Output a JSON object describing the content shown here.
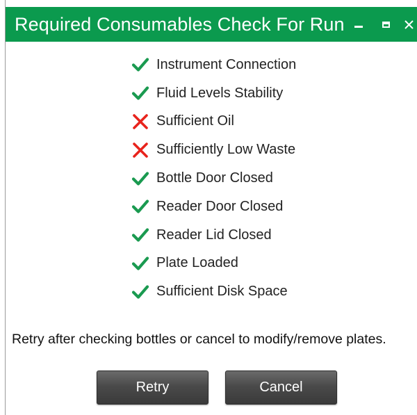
{
  "window": {
    "title": "Required Consumables Check For Run",
    "title_bar_color": "#0b9a4e",
    "controls": [
      "minimize-icon",
      "maximize-icon",
      "close-icon"
    ]
  },
  "checks": [
    {
      "label": "Instrument Connection",
      "status": "pass",
      "icon": "checkmark-icon"
    },
    {
      "label": "Fluid Levels Stability",
      "status": "pass",
      "icon": "checkmark-icon"
    },
    {
      "label": "Sufficient Oil",
      "status": "fail",
      "icon": "cross-icon"
    },
    {
      "label": "Sufficiently Low Waste",
      "status": "fail",
      "icon": "cross-icon"
    },
    {
      "label": "Bottle Door Closed",
      "status": "pass",
      "icon": "checkmark-icon"
    },
    {
      "label": "Reader Door Closed",
      "status": "pass",
      "icon": "checkmark-icon"
    },
    {
      "label": "Reader Lid Closed",
      "status": "pass",
      "icon": "checkmark-icon"
    },
    {
      "label": "Plate Loaded",
      "status": "pass",
      "icon": "checkmark-icon"
    },
    {
      "label": "Sufficient Disk Space",
      "status": "pass",
      "icon": "checkmark-icon"
    }
  ],
  "colors": {
    "pass": "#1a9a50",
    "fail": "#e8231c"
  },
  "message": "Retry after checking bottles or cancel to modify/remove plates.",
  "buttons": {
    "retry": "Retry",
    "cancel": "Cancel"
  }
}
